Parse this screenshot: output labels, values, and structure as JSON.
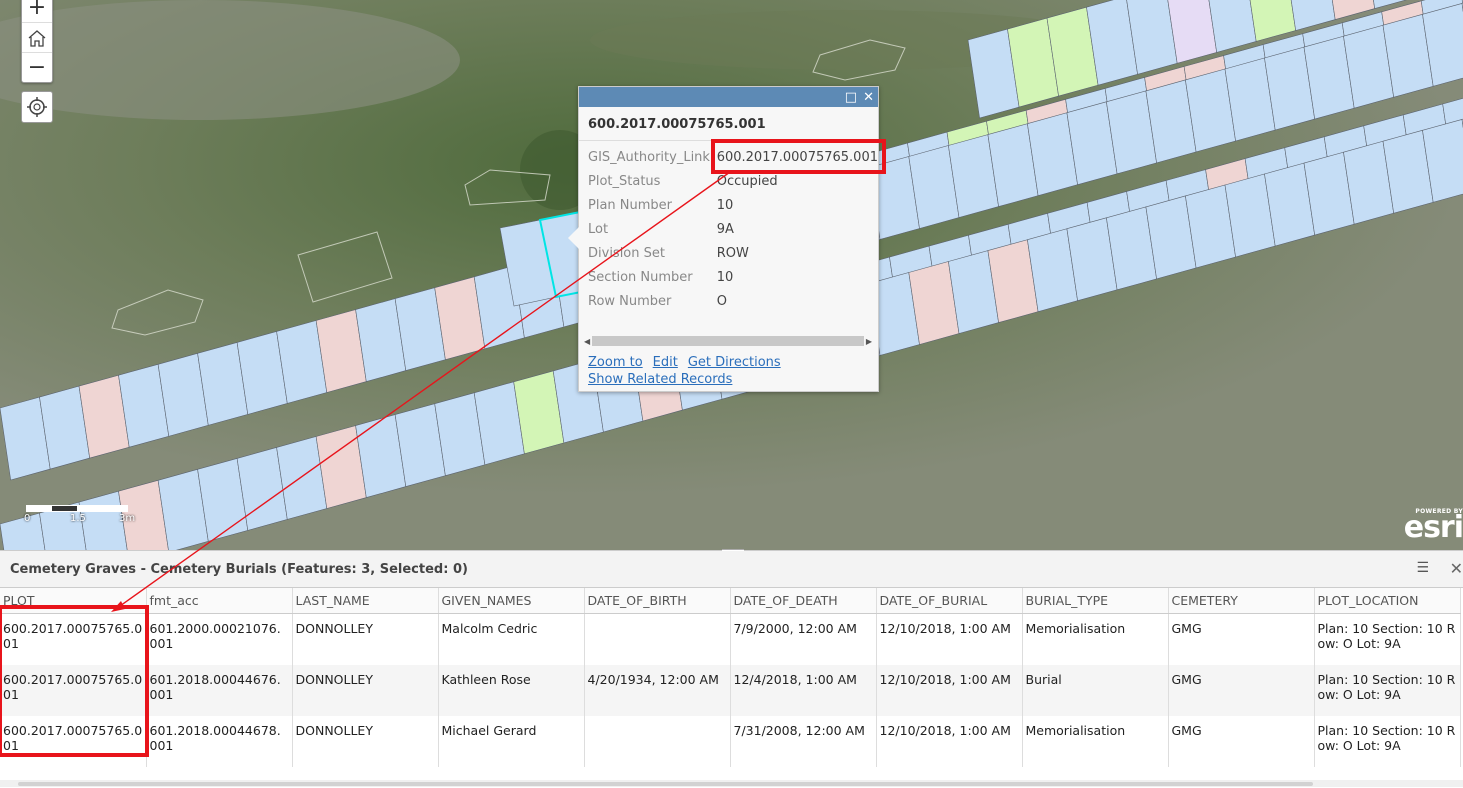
{
  "map": {
    "zoom_in": "+",
    "zoom_out": "−",
    "scale_labels": [
      "0",
      "1.5",
      "3m"
    ],
    "attribution_small": "POWERED BY",
    "attribution_logo": "esri"
  },
  "popup": {
    "title": "600.2017.00075765.001",
    "fields": [
      {
        "label": "GIS_Authority_Link",
        "value": "600.2017.00075765.001"
      },
      {
        "label": "Plot_Status",
        "value": "Occupied"
      },
      {
        "label": "Plan Number",
        "value": "10"
      },
      {
        "label": "Lot",
        "value": "9A"
      },
      {
        "label": "Division Set",
        "value": "ROW"
      },
      {
        "label": "Section Number",
        "value": "10"
      },
      {
        "label": "Row Number",
        "value": "O"
      }
    ],
    "actions": {
      "zoom_to": "Zoom to",
      "edit": "Edit",
      "get_directions": "Get Directions",
      "show_related": "Show Related Records"
    }
  },
  "table_panel": {
    "title": "Cemetery Graves - Cemetery Burials (Features: 3, Selected: 0)",
    "menu_icon": "☰",
    "close_icon": "✕",
    "columns": [
      "PLOT",
      "fmt_acc",
      "LAST_NAME",
      "GIVEN_NAMES",
      "DATE_OF_BIRTH",
      "DATE_OF_DEATH",
      "DATE_OF_BURIAL",
      "BURIAL_TYPE",
      "CEMETERY",
      "PLOT_LOCATION"
    ],
    "rows": [
      [
        "600.2017.00075765.001",
        "601.2000.00021076.001",
        "DONNOLLEY",
        "Malcolm Cedric",
        "",
        "7/9/2000, 12:00 AM",
        "12/10/2018, 1:00 AM",
        "Memorialisation",
        "GMG",
        "Plan: 10 Section: 10 Row: O Lot: 9A"
      ],
      [
        "600.2017.00075765.001",
        "601.2018.00044676.001",
        "DONNOLLEY",
        "Kathleen Rose",
        "4/20/1934, 12:00 AM",
        "12/4/2018, 1:00 AM",
        "12/10/2018, 1:00 AM",
        "Burial",
        "GMG",
        "Plan: 10 Section: 10 Row: O Lot: 9A"
      ],
      [
        "600.2017.00075765.001",
        "601.2018.00044678.001",
        "DONNOLLEY",
        "Michael Gerard",
        "",
        "7/31/2008, 12:00 AM",
        "12/10/2018, 1:00 AM",
        "Memorialisation",
        "GMG",
        "Plan: 10 Section: 10 Row: O Lot: 9A"
      ]
    ]
  },
  "colors": {
    "plot_default": "#c5ddf5",
    "plot_pink": "#efd5d3",
    "plot_green": "#d3f5b6",
    "plot_lavender": "#e6dcf5",
    "selected_outline": "#00e5e5",
    "annotation_red": "#e8141b",
    "popup_header": "#5d8ab5",
    "link": "#2a6ebb"
  }
}
